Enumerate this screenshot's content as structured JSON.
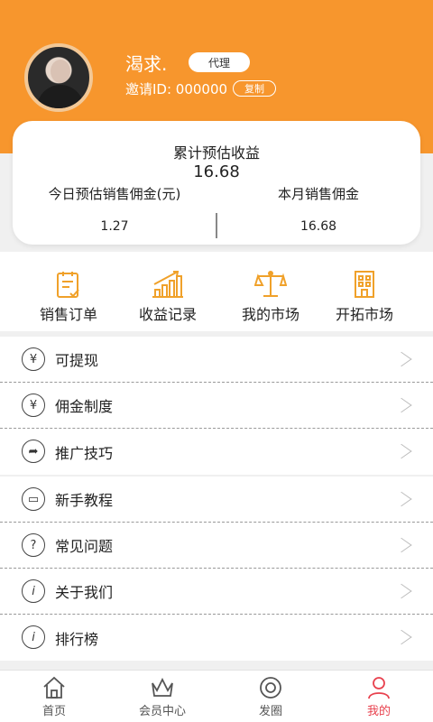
{
  "profile": {
    "username": "渴求.",
    "role_badge": "代理",
    "invite_text": "邀请ID: 000000",
    "copy_label": "复制"
  },
  "earnings": {
    "title": "累计预估收益",
    "total": "16.68",
    "today_label": "今日预估销售佣金(元)",
    "today_value": "1.27",
    "month_label": "本月销售佣金",
    "month_value": "16.68"
  },
  "quick_actions": [
    {
      "label": "销售订单",
      "icon": "order-list-icon"
    },
    {
      "label": "收益记录",
      "icon": "bar-chart-icon"
    },
    {
      "label": "我的市场",
      "icon": "scale-icon"
    },
    {
      "label": "开拓市场",
      "icon": "building-icon"
    }
  ],
  "menu_group1": [
    {
      "label": "可提现",
      "icon": "yuan-withdraw-icon"
    },
    {
      "label": "佣金制度",
      "icon": "yuan-icon"
    },
    {
      "label": "推广技巧",
      "icon": "share-icon"
    }
  ],
  "menu_group2": [
    {
      "label": "新手教程",
      "icon": "monitor-icon"
    },
    {
      "label": "常见问题",
      "icon": "question-icon"
    },
    {
      "label": "关于我们",
      "icon": "info-icon"
    },
    {
      "label": "排行榜",
      "icon": "info-icon"
    }
  ],
  "tabbar": [
    {
      "label": "首页",
      "icon": "home-icon",
      "active": false
    },
    {
      "label": "会员中心",
      "icon": "crown-icon",
      "active": false
    },
    {
      "label": "发圈",
      "icon": "circle-icon",
      "active": false
    },
    {
      "label": "我的",
      "icon": "user-icon",
      "active": true
    }
  ],
  "colors": {
    "accent": "#f7962d",
    "icon_gold": "#f0a12a",
    "active_tab": "#e8414e"
  }
}
